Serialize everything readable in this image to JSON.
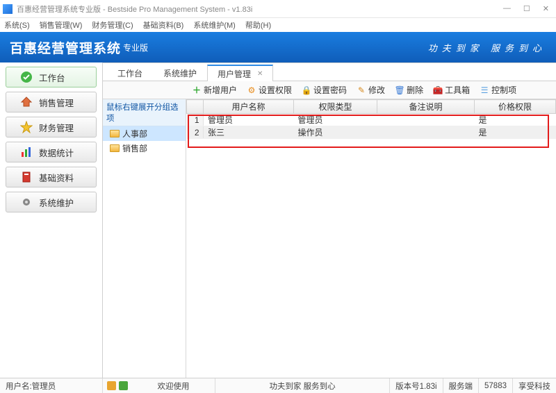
{
  "window": {
    "title": "百惠经营管理系统专业版 - Bestside Pro Management System - v1.83i"
  },
  "menubar": [
    "系统(S)",
    "销售管理(W)",
    "财务管理(C)",
    "基础资料(B)",
    "系统维护(M)",
    "帮助(H)"
  ],
  "banner": {
    "brand": "百惠经营管理系统",
    "sub": "专业版",
    "slogan": "功夫到家 服务到心"
  },
  "sidebar": [
    {
      "label": "工作台",
      "icon": "check-circle-icon",
      "primary": true
    },
    {
      "label": "销售管理",
      "icon": "house-icon"
    },
    {
      "label": "财务管理",
      "icon": "star-icon"
    },
    {
      "label": "数据统计",
      "icon": "bar-chart-icon"
    },
    {
      "label": "基础资料",
      "icon": "book-icon"
    },
    {
      "label": "系统维护",
      "icon": "gear-icon"
    }
  ],
  "tabs": [
    {
      "label": "工作台",
      "closable": false
    },
    {
      "label": "系统维护",
      "closable": false
    },
    {
      "label": "用户管理",
      "closable": true,
      "active": true
    }
  ],
  "toolbar": [
    {
      "label": "新增用户",
      "icon": "plus-icon",
      "color": "#2fa82f"
    },
    {
      "label": "设置权限",
      "icon": "gear-orange-icon",
      "color": "#e88b1a"
    },
    {
      "label": "设置密码",
      "icon": "lock-icon",
      "color": "#e8961a"
    },
    {
      "label": "修改",
      "icon": "pencil-icon",
      "color": "#d68a1f"
    },
    {
      "label": "删除",
      "icon": "trash-icon",
      "color": "#3a7bd5"
    },
    {
      "label": "工具箱",
      "icon": "toolbox-icon",
      "color": "#7b3fa0"
    },
    {
      "label": "控制项",
      "icon": "sliders-icon",
      "color": "#5aa0e0"
    }
  ],
  "tree": {
    "header": "鼠标右键展开分组选项",
    "items": [
      {
        "label": "人事部",
        "selected": true
      },
      {
        "label": "销售部",
        "selected": false
      }
    ]
  },
  "grid": {
    "columns": [
      "",
      "用户名称",
      "权限类型",
      "备注说明",
      "价格权限"
    ],
    "rows": [
      {
        "n": "1",
        "name": "管理员",
        "role": "管理员",
        "remark": "",
        "price": "是"
      },
      {
        "n": "2",
        "name": "张三",
        "role": "操作员",
        "remark": "",
        "price": "是",
        "selected": true
      }
    ]
  },
  "statusbar": {
    "user_label": "用户名:管理员",
    "welcome": "欢迎使用",
    "motto": "功夫到家 服务到心",
    "version": "版本号1.83i",
    "server": "服务端",
    "port": "57883",
    "company": "享受科技"
  }
}
